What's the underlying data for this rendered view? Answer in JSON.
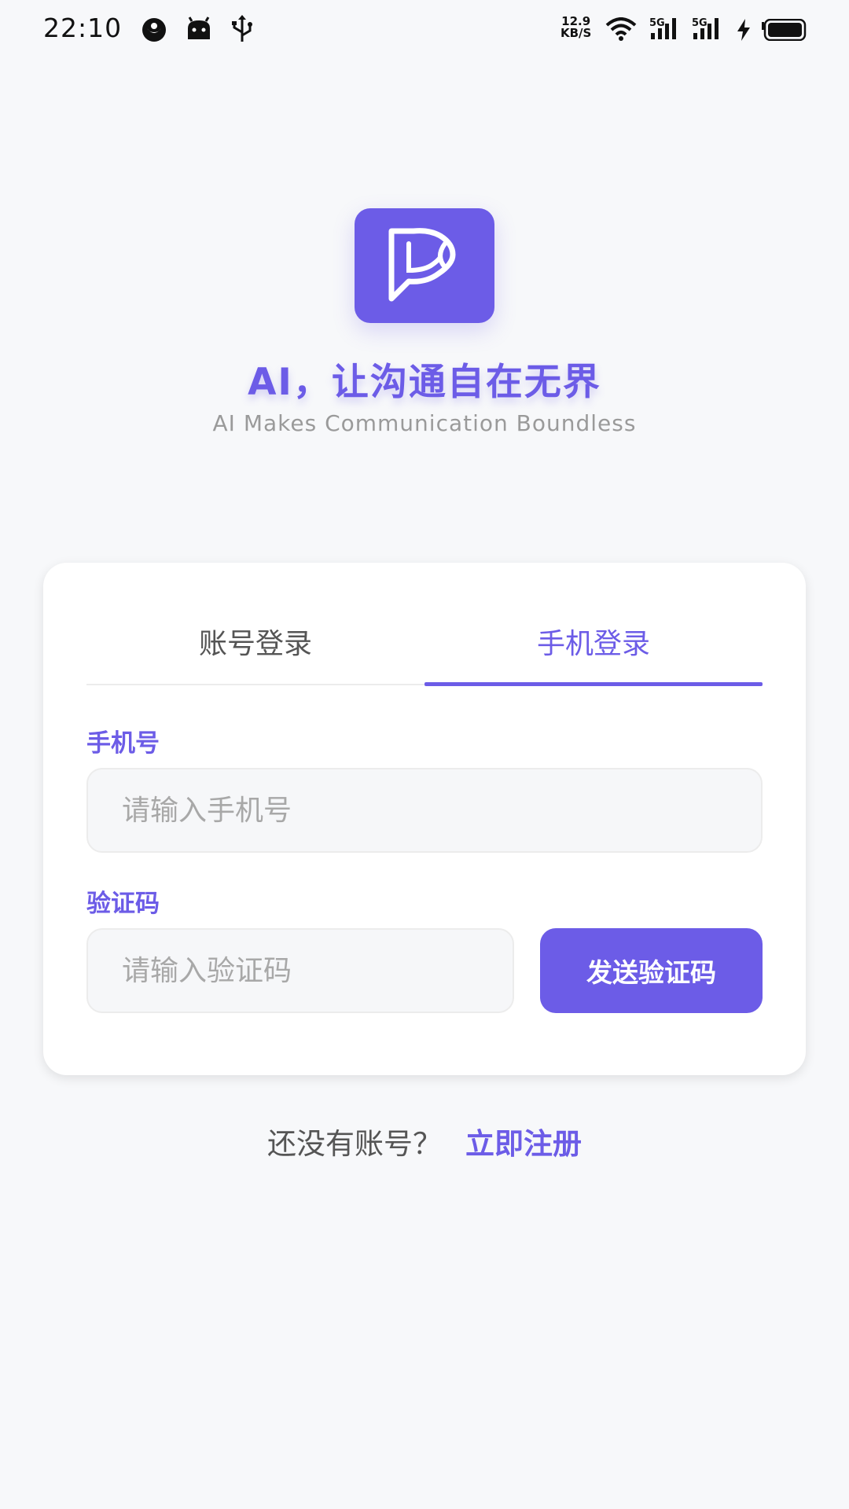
{
  "status_bar": {
    "time": "22:10",
    "net_speed_value": "12.9",
    "net_speed_unit": "KB/S",
    "signal_1_label": "5G",
    "signal_2_label": "5G"
  },
  "brand": {
    "tagline": "AI，让沟通自在无界",
    "tagline_en": "AI Makes Communication Boundless",
    "accent_color": "#6c5ce7"
  },
  "login_card": {
    "tabs": [
      {
        "label": "账号登录",
        "active": false
      },
      {
        "label": "手机登录",
        "active": true
      }
    ],
    "phone_label": "手机号",
    "phone_placeholder": "请输入手机号",
    "phone_value": "",
    "code_label": "验证码",
    "code_placeholder": "请输入验证码",
    "code_value": "",
    "send_code_label": "发送验证码"
  },
  "register": {
    "question": "还没有账号？",
    "link": "立即注册"
  }
}
